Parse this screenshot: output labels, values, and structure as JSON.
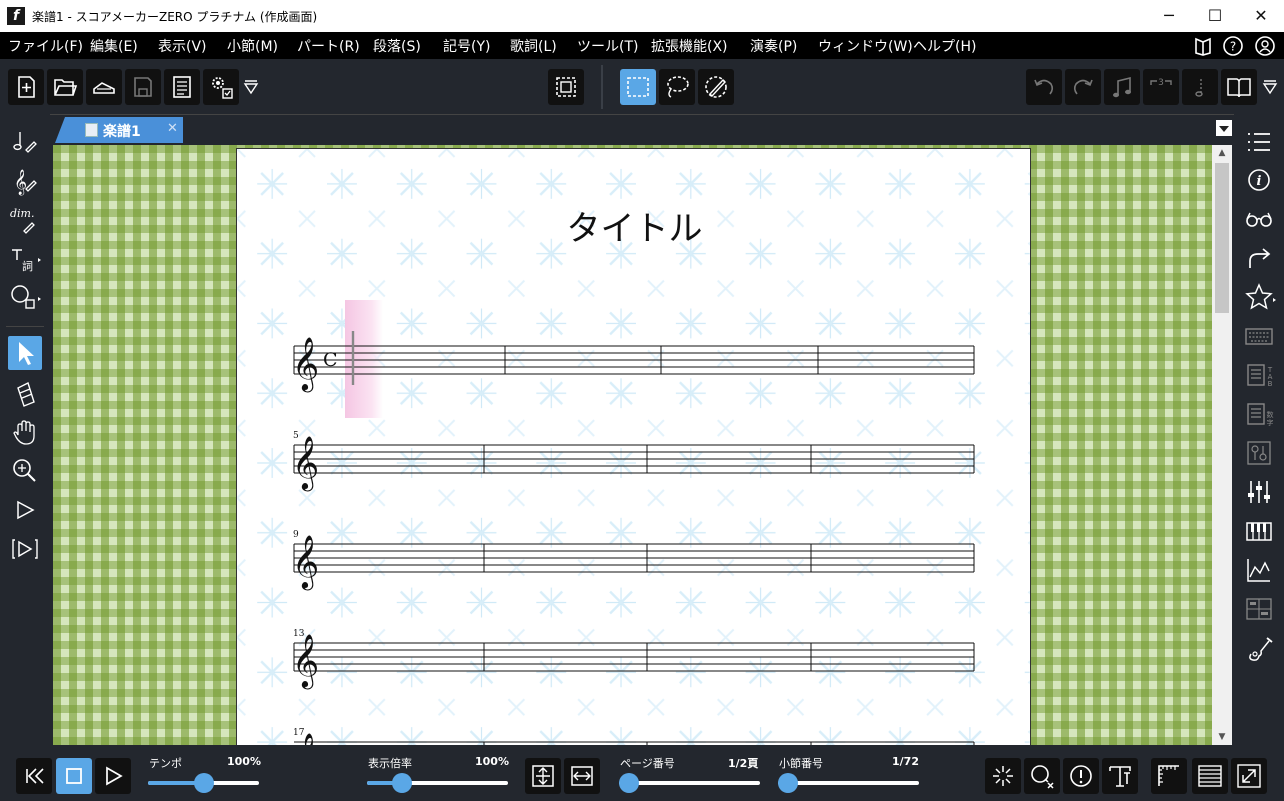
{
  "window": {
    "title": "楽譜1 - スコアメーカーZERO プラチナム (作成画面)",
    "app_icon": "f",
    "minimize": "─",
    "maximize": "☐",
    "close": "✕"
  },
  "menu": [
    "ファイル(F)",
    "編集(E)",
    "表示(V)",
    "小節(M)",
    "パート(R)",
    "段落(S)",
    "記号(Y)",
    "歌詞(L)",
    "ツール(T)",
    "拡張機能(X)",
    "演奏(P)",
    "ウィンドウ(W)",
    "ヘルプ(H)"
  ],
  "menu_right_icons": [
    "manual-icon",
    "help-icon",
    "account-icon"
  ],
  "tab": {
    "label": "楽譜1",
    "close": "✕"
  },
  "score": {
    "title": "タイトル",
    "time_signature": "C",
    "measure_numbers": [
      "5",
      "9",
      "13",
      "17"
    ],
    "measures_per_system": 4
  },
  "status": {
    "tempo_label": "テンポ",
    "tempo_value": "100%",
    "tempo_fraction": 0.5,
    "zoom_label": "表示倍率",
    "zoom_value": "100%",
    "zoom_fraction": 0.25,
    "page_label": "ページ番号",
    "page_value": "1/2頁",
    "page_fraction": 0.0,
    "measure_label": "小節番号",
    "measure_value": "1/72",
    "measure_fraction": 0.0
  },
  "colors": {
    "accent": "#5aa7e6",
    "toolbar_bg": "#23272e",
    "menubar_bg": "#000000",
    "page_check": "#8aaf43"
  }
}
